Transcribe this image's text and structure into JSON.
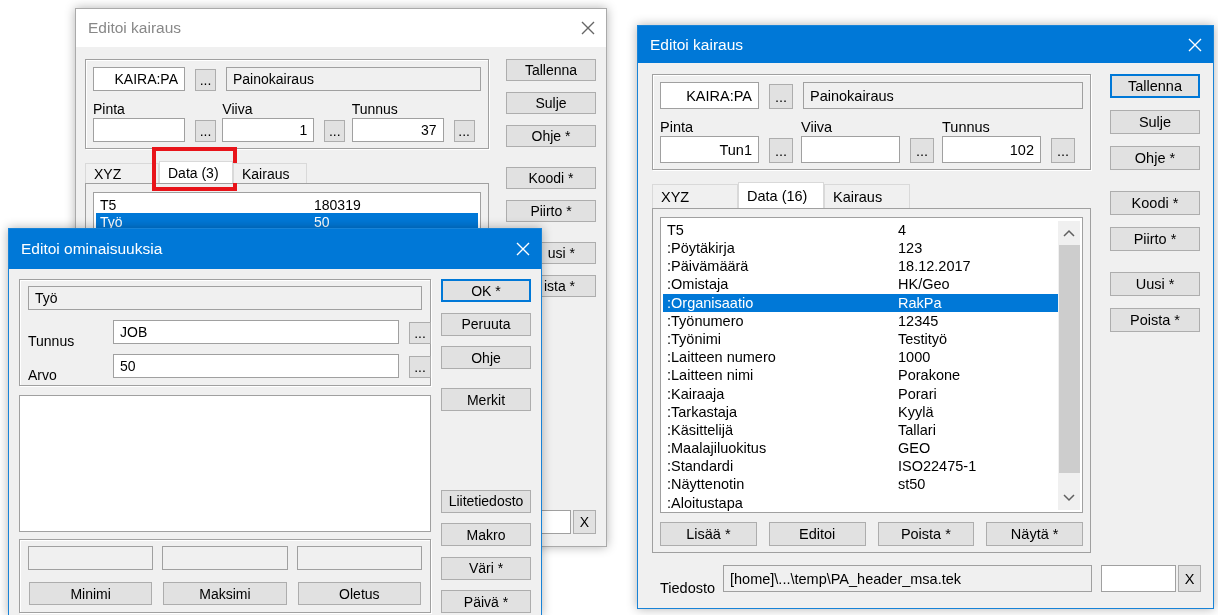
{
  "back_window": {
    "title": "Editoi kairaus",
    "active": false,
    "code": {
      "value": "KAIRA:PA",
      "button": "..."
    },
    "description": "Painokairaus",
    "fields": [
      {
        "label": "Pinta",
        "button": "..."
      },
      {
        "label": "Viiva",
        "value": "1",
        "button": "..."
      },
      {
        "label": "Tunnus",
        "value": "37",
        "button": "..."
      }
    ],
    "tabs": [
      {
        "label": "XYZ",
        "selected": false,
        "highlighted": false
      },
      {
        "label": "Data (3)",
        "selected": true,
        "highlighted": true
      },
      {
        "label": "Kairaus",
        "selected": false,
        "highlighted": false
      }
    ],
    "list": {
      "scrollable": false,
      "rows": [
        {
          "name": "T5",
          "value": "180319",
          "selected": false
        },
        {
          "name": "Työ",
          "value": "50",
          "selected": true
        }
      ]
    },
    "file": {
      "button": "X"
    },
    "buttons": [
      [
        {
          "label": "Tallenna",
          "default": false,
          "covered": false
        },
        {
          "label": "Sulje",
          "default": false,
          "covered": false
        },
        {
          "label": "Ohje *",
          "default": false,
          "covered": false
        }
      ],
      [
        {
          "label": "Koodi *",
          "default": false,
          "covered": false
        },
        {
          "label": "Piirto *",
          "default": false,
          "covered": false
        }
      ],
      [
        {
          "label": "usi *",
          "default": false,
          "covered": true
        },
        {
          "label": "ista *",
          "default": false,
          "covered": true
        }
      ]
    ]
  },
  "property_dialog": {
    "title": "Editoi ominaisuuksia",
    "active": true,
    "name": "Työ",
    "fields": [
      {
        "label": "Tunnus",
        "value": "JOB",
        "button": "..."
      },
      {
        "label": "Arvo",
        "value": "50",
        "button": "..."
      }
    ],
    "limit_buttons": [
      "Minimi",
      "Maksimi",
      "Oletus"
    ],
    "buttons": [
      [
        {
          "label": "OK *",
          "default": true
        },
        {
          "label": "Peruuta",
          "default": false
        },
        {
          "label": "Ohje",
          "default": false
        }
      ],
      [
        {
          "label": "Merkit",
          "default": false
        }
      ],
      [
        {
          "label": "Liitetiedosto",
          "default": false
        },
        {
          "label": "Makro",
          "default": false
        },
        {
          "label": "Väri *",
          "default": false
        },
        {
          "label": "Päivä *",
          "default": false
        }
      ]
    ]
  },
  "main_window": {
    "title": "Editoi kairaus",
    "active": true,
    "code": {
      "value": "KAIRA:PA",
      "button": "..."
    },
    "description": "Painokairaus",
    "fields": [
      {
        "label": "Pinta",
        "value": "Tun1",
        "button": "..."
      },
      {
        "label": "Viiva",
        "button": "..."
      },
      {
        "label": "Tunnus",
        "value": "102",
        "button": "..."
      }
    ],
    "tabs": [
      {
        "label": "XYZ",
        "selected": false,
        "highlighted": false
      },
      {
        "label": "Data (16)",
        "selected": true,
        "highlighted": false
      },
      {
        "label": "Kairaus",
        "selected": false,
        "highlighted": false
      }
    ],
    "list": {
      "scrollable": true,
      "rows": [
        {
          "name": "T5",
          "value": "4",
          "selected": false
        },
        {
          "name": ":Pöytäkirja",
          "value": "123",
          "selected": false
        },
        {
          "name": ":Päivämäärä",
          "value": "18.12.2017",
          "selected": false
        },
        {
          "name": ":Omistaja",
          "value": "HK/Geo",
          "selected": false
        },
        {
          "name": ":Organisaatio",
          "value": "RakPa",
          "selected": true
        },
        {
          "name": ":Työnumero",
          "value": "12345",
          "selected": false
        },
        {
          "name": ":Työnimi",
          "value": "Testityö",
          "selected": false
        },
        {
          "name": ":Laitteen numero",
          "value": "1000",
          "selected": false
        },
        {
          "name": ":Laitteen nimi",
          "value": "Porakone",
          "selected": false
        },
        {
          "name": ":Kairaaja",
          "value": "Porari",
          "selected": false
        },
        {
          "name": ":Tarkastaja",
          "value": "Kyylä",
          "selected": false
        },
        {
          "name": ":Käsittelijä",
          "value": "Tallari",
          "selected": false
        },
        {
          "name": ":Maalajiluokitus",
          "value": "GEO",
          "selected": false
        },
        {
          "name": ":Standardi",
          "value": "ISO22475-1",
          "selected": false
        },
        {
          "name": ":Näyttenotin",
          "value": "st50",
          "selected": false
        },
        {
          "name": ":Aloitustapa",
          "selected": false
        }
      ],
      "buttons": [
        "Lisää *",
        "Editoi",
        "Poista *",
        "Näytä *"
      ]
    },
    "file": {
      "label": "Tiedosto",
      "value": "[home]\\...\\temp\\PA_header_msa.tek",
      "button": "X"
    },
    "buttons": [
      [
        {
          "label": "Tallenna",
          "default": true,
          "covered": false
        },
        {
          "label": "Sulje",
          "default": false,
          "covered": false
        },
        {
          "label": "Ohje *",
          "default": false,
          "covered": false
        }
      ],
      [
        {
          "label": "Koodi *",
          "default": false,
          "covered": false
        },
        {
          "label": "Piirto *",
          "default": false,
          "covered": false
        }
      ],
      [
        {
          "label": "Uusi *",
          "default": false,
          "covered": false
        },
        {
          "label": "Poista *",
          "default": false,
          "covered": false
        }
      ]
    ]
  }
}
